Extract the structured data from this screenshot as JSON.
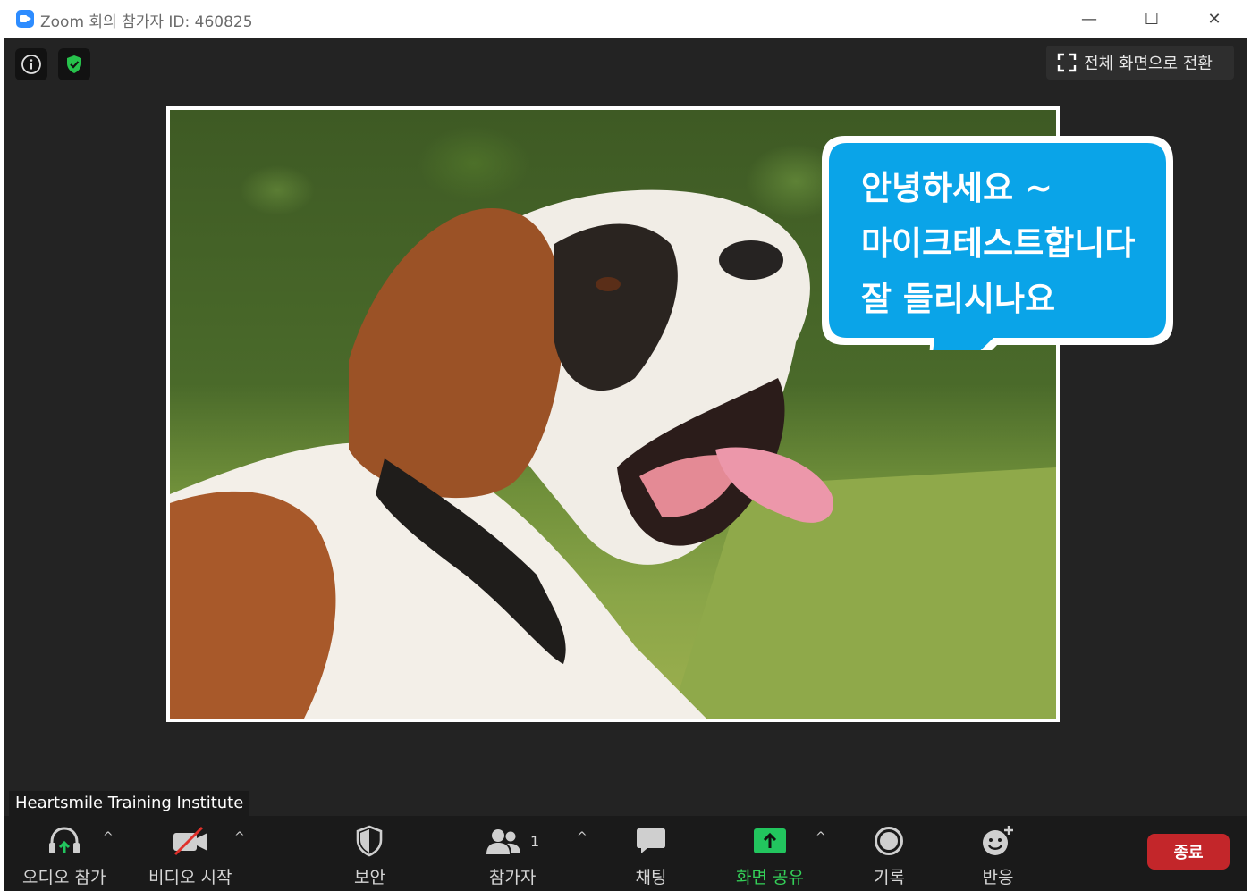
{
  "window": {
    "title": "Zoom 회의 참가자 ID: 460825",
    "controls": {
      "minimize": "—",
      "maximize": "☐",
      "close": "✕"
    }
  },
  "top_bar": {
    "info_icon": "info-icon",
    "security_icon": "shield-check-icon",
    "fullscreen_label": "전체 화면으로 전환"
  },
  "shared_content": {
    "speech_bubble_lines": [
      "안녕하세요 ~",
      "마이크테스트합니다",
      "잘 들리시나요"
    ]
  },
  "participant_name": "Heartsmile Training Institute",
  "toolbar": {
    "audio_label": "오디오 참가",
    "video_label": "비디오 시작",
    "security_label": "보안",
    "participants_label": "참가자",
    "participants_count": "1",
    "chat_label": "채팅",
    "share_label": "화면 공유",
    "record_label": "기록",
    "reactions_label": "반응",
    "end_label": "종료",
    "caret": "^"
  },
  "colors": {
    "accent": "#2d8cff",
    "share_green": "#22c55e",
    "end_red": "#c3262a",
    "bubble_blue": "#0aa4e8"
  }
}
